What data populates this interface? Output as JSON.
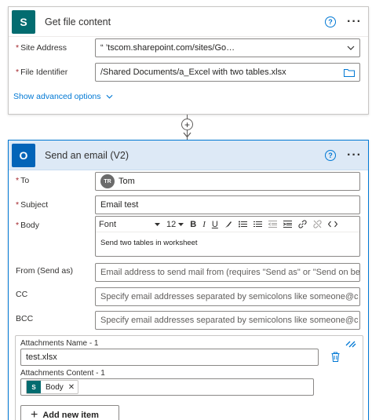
{
  "get_file": {
    "title": "Get file content",
    "site_address_label": "Site Address",
    "site_address_value": "“                             ’tscom.sharepoint.com/sites/Go…",
    "file_identifier_label": "File Identifier",
    "file_identifier_value": "/Shared Documents/a_Excel with two tables.xlsx",
    "advanced_options": "Show advanced options"
  },
  "send_email": {
    "title": "Send an email (V2)",
    "to_label": "To",
    "to_avatar": "TR",
    "to_name": "Tom",
    "subject_label": "Subject",
    "subject_value": "Email test",
    "body_label": "Body",
    "font_label": "Font",
    "font_size": "12",
    "body_text": "Send two tables in worksheet",
    "from_label": "From (Send as)",
    "from_placeholder": "Email address to send mail from (requires \"Send as\" or \"Send on be…",
    "cc_label": "CC",
    "cc_placeholder": "Specify email addresses separated by semicolons like someone@c…",
    "bcc_label": "BCC",
    "bcc_placeholder": "Specify email addresses separated by semicolons like someone@c…",
    "attachments_name_label": "Attachments Name - 1",
    "attachments_name_value": "test.xlsx",
    "attachments_content_label": "Attachments Content - 1",
    "attachments_content_token": "Body",
    "add_item": "Add new item"
  },
  "icons": {
    "sharepoint_letter": "S",
    "outlook_letter": "O",
    "help_glyph": "?",
    "more_glyph": "···",
    "plus_glyph": "+",
    "close_glyph": "✕"
  },
  "colors": {
    "accent": "#0078d4",
    "required": "#a4262c",
    "sharepoint": "#036c70",
    "outlook": "#0364b8",
    "header_active": "#dde9f6"
  }
}
